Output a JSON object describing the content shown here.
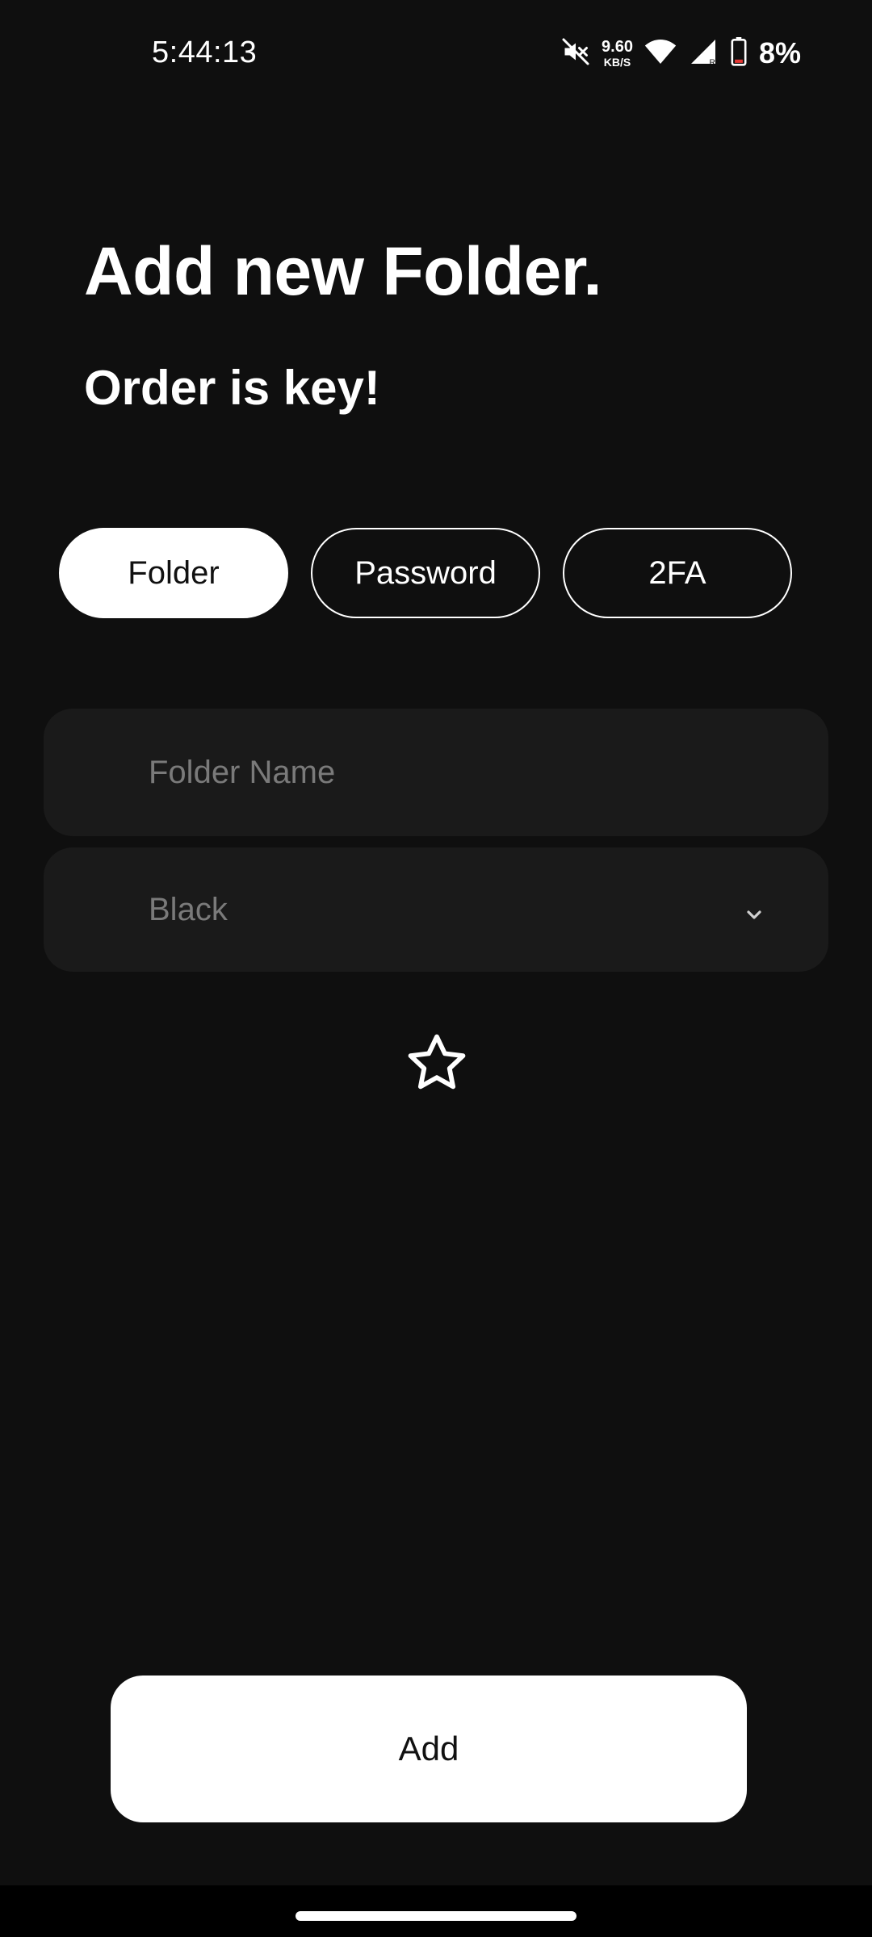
{
  "status_bar": {
    "time": "5:44:13",
    "net_speed_value": "9.60",
    "net_speed_unit": "KB/S",
    "battery_percent": "8%",
    "icons": [
      "mute-icon",
      "wifi-icon",
      "signal-icon",
      "battery-icon"
    ]
  },
  "header": {
    "title": "Add new Folder.",
    "subtitle": "Order is key!"
  },
  "tabs": [
    {
      "label": "Folder",
      "active": true
    },
    {
      "label": "Password",
      "active": false
    },
    {
      "label": "2FA",
      "active": false
    }
  ],
  "form": {
    "folder_name_placeholder": "Folder Name",
    "folder_name_value": "",
    "color_select_value": "Black",
    "favorite_icon": "star-outline-icon"
  },
  "actions": {
    "add_label": "Add"
  },
  "colors": {
    "background": "#0f0f0f",
    "field_background": "#1a1a1a",
    "accent": "#ffffff",
    "placeholder": "#7a7a7a"
  }
}
